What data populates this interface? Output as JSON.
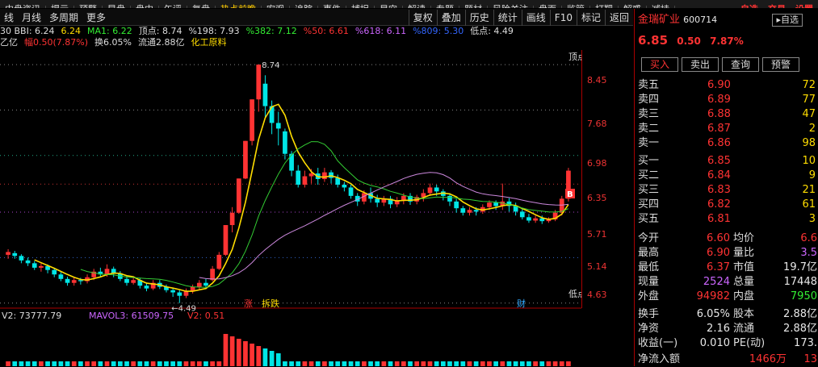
{
  "topbar": [
    "中盘资讯",
    "提示",
    "预警",
    "早盘",
    "盘中",
    "午评",
    "复盘",
    "热点前瞻",
    "宏观",
    "追踪",
    "事件",
    "捕捉",
    "星空",
    "解读",
    "专题",
    "题材",
    "风险关注",
    "盘面",
    "监管",
    "打靶",
    "解惑",
    "减持"
  ],
  "topbar_right": [
    "自选",
    "交易",
    "设置"
  ],
  "toolbar": {
    "left": [
      "线",
      "月线",
      "多周期",
      "更多"
    ],
    "right": [
      "复权",
      "叠加",
      "历史",
      "统计",
      "画线",
      "F10",
      "标记",
      "返回"
    ]
  },
  "indicators": {
    "line1": [
      {
        "t": "30 BBI: 6.24",
        "c": "#dddddd"
      },
      {
        "t": "6.24",
        "c": "#ffdd00"
      },
      {
        "t": "MA1: 6.22",
        "c": "#33ee33"
      },
      {
        "t": "顶点: 8.74",
        "c": "#dddddd"
      },
      {
        "t": "%198: 7.93",
        "c": "#dddddd"
      },
      {
        "t": "%382: 7.12",
        "c": "#33ee33"
      },
      {
        "t": "%50: 6.61",
        "c": "#ff3333"
      },
      {
        "t": "%618: 6.11",
        "c": "#cc66ff"
      },
      {
        "t": "%809: 5.30",
        "c": "#3366ff"
      },
      {
        "t": "低点: 4.49",
        "c": "#dddddd"
      }
    ],
    "line2": [
      {
        "t": "乙亿",
        "c": "#dddddd"
      },
      {
        "t": "幅0.50(7.87%)",
        "c": "#ff3333"
      },
      {
        "t": "换6.05%",
        "c": "#dddddd"
      },
      {
        "t": "流通2.88亿",
        "c": "#dddddd"
      },
      {
        "t": "化工原料",
        "c": "#ffdd00"
      }
    ]
  },
  "chart_labels": {
    "top_value": "8.74",
    "low_value": "4.49",
    "top_marker": "顶点",
    "low_marker": "低点",
    "zhang": "涨",
    "fupai": "拆跌",
    "cai": "财",
    "b_marker": "B"
  },
  "price_axis": [
    {
      "v": "8.45"
    },
    {
      "v": "7.68"
    },
    {
      "v": "6.98"
    },
    {
      "v": "6.35"
    },
    {
      "v": "5.71"
    },
    {
      "v": "5.14"
    },
    {
      "v": "4.63"
    }
  ],
  "volume": {
    "label": "V2: 73777.79",
    "mavol": "MAVOL3: 61509.75",
    "v2": "V2: 0.51",
    "axis": "30000"
  },
  "stock": {
    "name": "金瑞矿业",
    "code": "600714",
    "price": "6.85",
    "change": "0.50",
    "pct": "7.87%",
    "ctrl": "自选"
  },
  "buttons": [
    "买入",
    "卖出",
    "查询",
    "预警"
  ],
  "sell": [
    {
      "label": "卖五",
      "price": "6.90",
      "vol": "72"
    },
    {
      "label": "卖四",
      "price": "6.89",
      "vol": "77"
    },
    {
      "label": "卖三",
      "price": "6.88",
      "vol": "47"
    },
    {
      "label": "卖二",
      "price": "6.87",
      "vol": "2"
    },
    {
      "label": "卖一",
      "price": "6.86",
      "vol": "98"
    }
  ],
  "buy": [
    {
      "label": "买一",
      "price": "6.85",
      "vol": "10"
    },
    {
      "label": "买二",
      "price": "6.84",
      "vol": "9"
    },
    {
      "label": "买三",
      "price": "6.83",
      "vol": "21"
    },
    {
      "label": "买四",
      "price": "6.82",
      "vol": "61"
    },
    {
      "label": "买五",
      "price": "6.81",
      "vol": "3"
    }
  ],
  "stats": [
    {
      "a": "今开",
      "av": "6.60",
      "ac": "#ff3333",
      "b": "均价",
      "bv": "6.6",
      "bc": "#ff3333"
    },
    {
      "a": "最高",
      "av": "6.90",
      "ac": "#ff3333",
      "b": "量比",
      "bv": "3.5",
      "bc": "#cc66ff"
    },
    {
      "a": "最低",
      "av": "6.37",
      "ac": "#ff3333",
      "b": "市值",
      "bv": "19.7亿",
      "bc": "#e8e8e8"
    },
    {
      "a": "现量",
      "av": "2524",
      "ac": "#cc66ff",
      "b": "总量",
      "bv": "17448",
      "bc": "#e8e8e8"
    },
    {
      "a": "外盘",
      "av": "94982",
      "ac": "#ff3333",
      "b": "内盘",
      "bv": "7950",
      "bc": "#33ee33"
    }
  ],
  "stats2": [
    {
      "a": "换手",
      "av": "6.05%",
      "b": "股本",
      "bv": "2.88亿"
    },
    {
      "a": "净资",
      "av": "2.16",
      "b": "流通",
      "bv": "2.88亿"
    },
    {
      "a": "收益(一)",
      "av": "0.010",
      "b": "PE(动)",
      "bv": "173."
    }
  ],
  "netflow": {
    "label": "净流入额",
    "value": "1466万",
    "extra": "13"
  },
  "chart_data": {
    "type": "candlestick",
    "ylim": [
      4.4,
      9.0
    ],
    "candles": [
      [
        5.35,
        5.4,
        5.28,
        5.45
      ],
      [
        5.38,
        5.33,
        5.28,
        5.42
      ],
      [
        5.33,
        5.25,
        5.2,
        5.36
      ],
      [
        5.25,
        5.2,
        5.15,
        5.3
      ],
      [
        5.2,
        5.12,
        5.08,
        5.24
      ],
      [
        5.12,
        5.15,
        5.05,
        5.2
      ],
      [
        5.15,
        5.08,
        5.02,
        5.18
      ],
      [
        5.08,
        5.0,
        4.95,
        5.12
      ],
      [
        5.0,
        4.92,
        4.88,
        5.04
      ],
      [
        4.92,
        4.85,
        4.8,
        4.96
      ],
      [
        4.85,
        4.9,
        4.8,
        4.95
      ],
      [
        4.9,
        4.88,
        4.82,
        4.94
      ],
      [
        4.88,
        4.95,
        4.84,
        5.0
      ],
      [
        4.95,
        5.05,
        4.9,
        5.1
      ],
      [
        5.05,
        5.0,
        4.95,
        5.12
      ],
      [
        5.0,
        5.1,
        4.96,
        5.18
      ],
      [
        5.1,
        5.02,
        4.95,
        5.14
      ],
      [
        5.02,
        4.92,
        4.88,
        5.06
      ],
      [
        4.92,
        4.85,
        4.8,
        4.98
      ],
      [
        4.85,
        4.9,
        4.82,
        4.95
      ],
      [
        4.9,
        4.8,
        4.75,
        4.94
      ],
      [
        4.8,
        4.75,
        4.7,
        4.85
      ],
      [
        4.75,
        4.85,
        4.72,
        4.9
      ],
      [
        4.85,
        4.78,
        4.74,
        4.9
      ],
      [
        4.78,
        4.72,
        4.68,
        4.82
      ],
      [
        4.72,
        4.68,
        4.6,
        4.76
      ],
      [
        4.68,
        4.62,
        4.49,
        4.72
      ],
      [
        4.62,
        4.7,
        4.58,
        4.75
      ],
      [
        4.7,
        4.78,
        4.66,
        4.82
      ],
      [
        4.78,
        4.85,
        4.74,
        4.9
      ],
      [
        4.85,
        4.8,
        4.76,
        4.92
      ],
      [
        4.9,
        5.1,
        4.88,
        5.15
      ],
      [
        5.1,
        5.35,
        5.08,
        5.4
      ],
      [
        5.35,
        5.88,
        5.33,
        5.88
      ],
      [
        5.88,
        6.1,
        5.75,
        6.2
      ],
      [
        6.1,
        6.71,
        6.08,
        6.71
      ],
      [
        6.71,
        7.38,
        6.7,
        7.38
      ],
      [
        7.38,
        8.12,
        7.3,
        8.12
      ],
      [
        8.12,
        8.74,
        7.9,
        8.74
      ],
      [
        8.4,
        8.0,
        7.8,
        8.55
      ],
      [
        8.0,
        7.7,
        7.5,
        8.1
      ],
      [
        7.7,
        7.6,
        7.3,
        7.9
      ],
      [
        7.55,
        7.15,
        7.05,
        7.6
      ],
      [
        7.15,
        6.85,
        6.75,
        7.2
      ],
      [
        6.85,
        6.6,
        6.55,
        6.95
      ],
      [
        6.6,
        6.75,
        6.55,
        6.85
      ],
      [
        6.75,
        6.8,
        6.62,
        6.88
      ],
      [
        6.8,
        6.7,
        6.6,
        6.9
      ],
      [
        6.7,
        6.82,
        6.65,
        6.9
      ],
      [
        6.82,
        6.72,
        6.62,
        6.86
      ],
      [
        6.72,
        6.6,
        6.55,
        6.78
      ],
      [
        6.6,
        6.55,
        6.48,
        6.65
      ],
      [
        6.55,
        6.4,
        6.35,
        6.6
      ],
      [
        6.4,
        6.3,
        6.22,
        6.45
      ],
      [
        6.3,
        6.45,
        6.25,
        6.5
      ],
      [
        6.45,
        6.35,
        6.28,
        6.55
      ],
      [
        6.35,
        6.28,
        6.2,
        6.42
      ],
      [
        6.28,
        6.35,
        6.22,
        6.4
      ],
      [
        6.35,
        6.25,
        6.18,
        6.4
      ],
      [
        6.25,
        6.32,
        6.2,
        6.38
      ],
      [
        6.32,
        6.4,
        6.25,
        6.45
      ],
      [
        6.4,
        6.3,
        6.24,
        6.45
      ],
      [
        6.3,
        6.38,
        6.25,
        6.42
      ],
      [
        6.38,
        6.45,
        6.3,
        6.52
      ],
      [
        6.45,
        6.55,
        6.4,
        6.62
      ],
      [
        6.55,
        6.48,
        6.4,
        6.6
      ],
      [
        6.48,
        6.4,
        6.32,
        6.52
      ],
      [
        6.4,
        6.3,
        6.22,
        6.45
      ],
      [
        6.3,
        6.18,
        6.1,
        6.35
      ],
      [
        6.18,
        6.1,
        6.05,
        6.22
      ],
      [
        6.1,
        6.15,
        6.05,
        6.2
      ],
      [
        6.15,
        6.12,
        6.05,
        6.2
      ],
      [
        6.12,
        6.2,
        6.08,
        6.25
      ],
      [
        6.2,
        6.28,
        6.15,
        6.32
      ],
      [
        6.28,
        6.22,
        6.15,
        6.32
      ],
      [
        6.22,
        6.3,
        6.15,
        6.62
      ],
      [
        6.3,
        6.22,
        6.12,
        6.36
      ],
      [
        6.22,
        6.12,
        6.05,
        6.28
      ],
      [
        6.12,
        6.02,
        5.98,
        6.18
      ],
      [
        6.02,
        5.96,
        5.92,
        6.08
      ],
      [
        5.96,
        6.0,
        5.92,
        6.05
      ],
      [
        6.0,
        5.95,
        5.9,
        6.05
      ],
      [
        5.95,
        5.98,
        5.92,
        6.02
      ],
      [
        5.98,
        6.1,
        5.95,
        6.15
      ],
      [
        6.1,
        6.35,
        6.05,
        6.4
      ],
      [
        6.35,
        6.85,
        6.3,
        6.9
      ]
    ]
  }
}
